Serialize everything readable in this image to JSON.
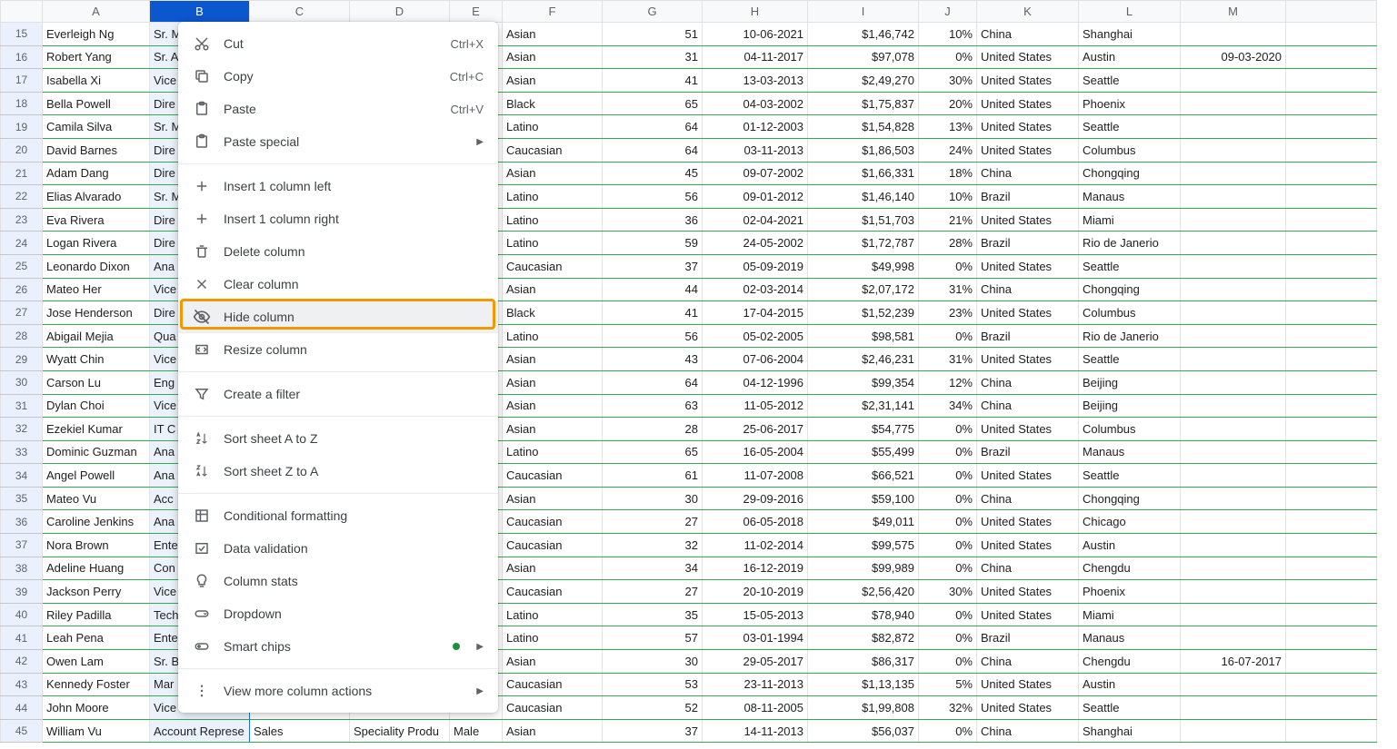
{
  "columns": [
    "A",
    "B",
    "C",
    "D",
    "E",
    "F",
    "G",
    "H",
    "I",
    "J",
    "K",
    "L",
    "M"
  ],
  "startRow": 15,
  "selectedColumn": "B",
  "rows": [
    {
      "n": 15,
      "A": "Everleigh Ng",
      "B": "Sr. M",
      "C": "",
      "D": "",
      "E": "",
      "F": "Asian",
      "G": "51",
      "H": "10-06-2021",
      "I": "$1,46,742",
      "J": "10%",
      "K": "China",
      "L": "Shanghai",
      "M": ""
    },
    {
      "n": 16,
      "A": "Robert Yang",
      "B": "Sr. A",
      "C": "",
      "D": "",
      "E": "",
      "F": "Asian",
      "G": "31",
      "H": "04-11-2017",
      "I": "$97,078",
      "J": "0%",
      "K": "United States",
      "L": "Austin",
      "M": "09-03-2020"
    },
    {
      "n": 17,
      "A": "Isabella Xi",
      "B": "Vice",
      "C": "",
      "D": "",
      "E": "e",
      "F": "Asian",
      "G": "41",
      "H": "13-03-2013",
      "I": "$2,49,270",
      "J": "30%",
      "K": "United States",
      "L": "Seattle",
      "M": ""
    },
    {
      "n": 18,
      "A": "Bella Powell",
      "B": "Dire",
      "C": "",
      "D": "",
      "E": "e",
      "F": "Black",
      "G": "65",
      "H": "04-03-2002",
      "I": "$1,75,837",
      "J": "20%",
      "K": "United States",
      "L": "Phoenix",
      "M": ""
    },
    {
      "n": 19,
      "A": "Camila Silva",
      "B": "Sr. M",
      "C": "",
      "D": "",
      "E": "e",
      "F": "Latino",
      "G": "64",
      "H": "01-12-2003",
      "I": "$1,54,828",
      "J": "13%",
      "K": "United States",
      "L": "Seattle",
      "M": ""
    },
    {
      "n": 20,
      "A": "David Barnes",
      "B": "Dire",
      "C": "",
      "D": "",
      "E": "",
      "F": "Caucasian",
      "G": "64",
      "H": "03-11-2013",
      "I": "$1,86,503",
      "J": "24%",
      "K": "United States",
      "L": "Columbus",
      "M": ""
    },
    {
      "n": 21,
      "A": "Adam Dang",
      "B": "Dire",
      "C": "",
      "D": "",
      "E": "",
      "F": "Asian",
      "G": "45",
      "H": "09-07-2002",
      "I": "$1,66,331",
      "J": "18%",
      "K": "China",
      "L": "Chongqing",
      "M": ""
    },
    {
      "n": 22,
      "A": "Elias Alvarado",
      "B": "Sr. M",
      "C": "",
      "D": "",
      "E": "",
      "F": "Latino",
      "G": "56",
      "H": "09-01-2012",
      "I": "$1,46,140",
      "J": "10%",
      "K": "Brazil",
      "L": "Manaus",
      "M": ""
    },
    {
      "n": 23,
      "A": "Eva Rivera",
      "B": "Dire",
      "C": "",
      "D": "",
      "E": "e",
      "F": "Latino",
      "G": "36",
      "H": "02-04-2021",
      "I": "$1,51,703",
      "J": "21%",
      "K": "United States",
      "L": "Miami",
      "M": ""
    },
    {
      "n": 24,
      "A": "Logan Rivera",
      "B": "Dire",
      "C": "",
      "D": "",
      "E": "",
      "F": "Latino",
      "G": "59",
      "H": "24-05-2002",
      "I": "$1,72,787",
      "J": "28%",
      "K": "Brazil",
      "L": "Rio de Janerio",
      "M": ""
    },
    {
      "n": 25,
      "A": "Leonardo Dixon",
      "B": "Ana",
      "C": "",
      "D": "",
      "E": "",
      "F": "Caucasian",
      "G": "37",
      "H": "05-09-2019",
      "I": "$49,998",
      "J": "0%",
      "K": "United States",
      "L": "Seattle",
      "M": ""
    },
    {
      "n": 26,
      "A": "Mateo Her",
      "B": "Vice",
      "C": "",
      "D": "",
      "E": "",
      "F": "Asian",
      "G": "44",
      "H": "02-03-2014",
      "I": "$2,07,172",
      "J": "31%",
      "K": "China",
      "L": "Chongqing",
      "M": ""
    },
    {
      "n": 27,
      "A": "Jose Henderson",
      "B": "Dire",
      "C": "",
      "D": "",
      "E": "",
      "F": "Black",
      "G": "41",
      "H": "17-04-2015",
      "I": "$1,52,239",
      "J": "23%",
      "K": "United States",
      "L": "Columbus",
      "M": ""
    },
    {
      "n": 28,
      "A": "Abigail Mejia",
      "B": "Qua",
      "C": "",
      "D": "",
      "E": "e",
      "F": "Latino",
      "G": "56",
      "H": "05-02-2005",
      "I": "$98,581",
      "J": "0%",
      "K": "Brazil",
      "L": "Rio de Janerio",
      "M": ""
    },
    {
      "n": 29,
      "A": "Wyatt Chin",
      "B": "Vice",
      "C": "",
      "D": "",
      "E": "",
      "F": "Asian",
      "G": "43",
      "H": "07-06-2004",
      "I": "$2,46,231",
      "J": "31%",
      "K": "United States",
      "L": "Seattle",
      "M": ""
    },
    {
      "n": 30,
      "A": "Carson Lu",
      "B": "Eng",
      "C": "",
      "D": "",
      "E": "",
      "F": "Asian",
      "G": "64",
      "H": "04-12-1996",
      "I": "$99,354",
      "J": "12%",
      "K": "China",
      "L": "Beijing",
      "M": ""
    },
    {
      "n": 31,
      "A": "Dylan Choi",
      "B": "Vice",
      "C": "",
      "D": "",
      "E": "",
      "F": "Asian",
      "G": "63",
      "H": "11-05-2012",
      "I": "$2,31,141",
      "J": "34%",
      "K": "China",
      "L": "Beijing",
      "M": ""
    },
    {
      "n": 32,
      "A": "Ezekiel Kumar",
      "B": "IT C",
      "C": "",
      "D": "",
      "E": "",
      "F": "Asian",
      "G": "28",
      "H": "25-06-2017",
      "I": "$54,775",
      "J": "0%",
      "K": "United States",
      "L": "Columbus",
      "M": ""
    },
    {
      "n": 33,
      "A": "Dominic Guzman",
      "B": "Ana",
      "C": "",
      "D": "",
      "E": "",
      "F": "Latino",
      "G": "65",
      "H": "16-05-2004",
      "I": "$55,499",
      "J": "0%",
      "K": "Brazil",
      "L": "Manaus",
      "M": ""
    },
    {
      "n": 34,
      "A": "Angel Powell",
      "B": "Ana",
      "C": "",
      "D": "",
      "E": "e",
      "F": "Caucasian",
      "G": "61",
      "H": "11-07-2008",
      "I": "$66,521",
      "J": "0%",
      "K": "United States",
      "L": "Seattle",
      "M": ""
    },
    {
      "n": 35,
      "A": "Mateo Vu",
      "B": "Acc",
      "C": "",
      "D": "",
      "E": "",
      "F": "Asian",
      "G": "30",
      "H": "29-09-2016",
      "I": "$59,100",
      "J": "0%",
      "K": "China",
      "L": "Chongqing",
      "M": ""
    },
    {
      "n": 36,
      "A": "Caroline Jenkins",
      "B": "Ana",
      "C": "",
      "D": "",
      "E": "e",
      "F": "Caucasian",
      "G": "27",
      "H": "06-05-2018",
      "I": "$49,011",
      "J": "0%",
      "K": "United States",
      "L": "Chicago",
      "M": ""
    },
    {
      "n": 37,
      "A": "Nora Brown",
      "B": "Ente",
      "C": "",
      "D": "",
      "E": "e",
      "F": "Caucasian",
      "G": "32",
      "H": "11-02-2014",
      "I": "$99,575",
      "J": "0%",
      "K": "United States",
      "L": "Austin",
      "M": ""
    },
    {
      "n": 38,
      "A": "Adeline Huang",
      "B": "Con",
      "C": "",
      "D": "",
      "E": "e",
      "F": "Asian",
      "G": "34",
      "H": "16-12-2019",
      "I": "$99,989",
      "J": "0%",
      "K": "China",
      "L": "Chengdu",
      "M": ""
    },
    {
      "n": 39,
      "A": "Jackson Perry",
      "B": "Vice",
      "C": "",
      "D": "",
      "E": "",
      "F": "Caucasian",
      "G": "27",
      "H": "20-10-2019",
      "I": "$2,56,420",
      "J": "30%",
      "K": "United States",
      "L": "Phoenix",
      "M": ""
    },
    {
      "n": 40,
      "A": "Riley Padilla",
      "B": "Tech",
      "C": "",
      "D": "",
      "E": "e",
      "F": "Latino",
      "G": "35",
      "H": "15-05-2013",
      "I": "$78,940",
      "J": "0%",
      "K": "United States",
      "L": "Miami",
      "M": ""
    },
    {
      "n": 41,
      "A": "Leah Pena",
      "B": "Ente",
      "C": "",
      "D": "",
      "E": "e",
      "F": "Latino",
      "G": "57",
      "H": "03-01-1994",
      "I": "$82,872",
      "J": "0%",
      "K": "Brazil",
      "L": "Manaus",
      "M": ""
    },
    {
      "n": 42,
      "A": "Owen Lam",
      "B": "Sr. B",
      "C": "",
      "D": "",
      "E": "",
      "F": "Asian",
      "G": "30",
      "H": "29-05-2017",
      "I": "$86,317",
      "J": "0%",
      "K": "China",
      "L": "Chengdu",
      "M": "16-07-2017"
    },
    {
      "n": 43,
      "A": "Kennedy Foster",
      "B": "Mar",
      "C": "",
      "D": "",
      "E": "e",
      "F": "Caucasian",
      "G": "53",
      "H": "23-11-2013",
      "I": "$1,13,135",
      "J": "5%",
      "K": "United States",
      "L": "Austin",
      "M": ""
    },
    {
      "n": 44,
      "A": "John Moore",
      "B": "Vice",
      "C": "",
      "D": "",
      "E": "",
      "F": "Caucasian",
      "G": "52",
      "H": "08-11-2005",
      "I": "$1,99,808",
      "J": "32%",
      "K": "United States",
      "L": "Seattle",
      "M": ""
    },
    {
      "n": 45,
      "A": "William Vu",
      "B": "Account Represe",
      "C": "Sales",
      "D": "Speciality Produ",
      "E": "Male",
      "F": "Asian",
      "G": "37",
      "H": "14-11-2013",
      "I": "$56,037",
      "J": "0%",
      "K": "China",
      "L": "Shanghai",
      "M": ""
    }
  ],
  "menu": {
    "cut": {
      "label": "Cut",
      "short": "Ctrl+X"
    },
    "copy": {
      "label": "Copy",
      "short": "Ctrl+C"
    },
    "paste": {
      "label": "Paste",
      "short": "Ctrl+V"
    },
    "paste_special": {
      "label": "Paste special"
    },
    "insert_left": {
      "label": "Insert 1 column left"
    },
    "insert_right": {
      "label": "Insert 1 column right"
    },
    "delete_col": {
      "label": "Delete column"
    },
    "clear_col": {
      "label": "Clear column"
    },
    "hide_col": {
      "label": "Hide column"
    },
    "resize_col": {
      "label": "Resize column"
    },
    "create_filter": {
      "label": "Create a filter"
    },
    "sort_az": {
      "label": "Sort sheet A to Z"
    },
    "sort_za": {
      "label": "Sort sheet Z to A"
    },
    "cond_fmt": {
      "label": "Conditional formatting"
    },
    "data_val": {
      "label": "Data validation"
    },
    "col_stats": {
      "label": "Column stats"
    },
    "dropdown": {
      "label": "Dropdown"
    },
    "smart_chips": {
      "label": "Smart chips"
    },
    "view_more": {
      "label": "View more column actions"
    }
  }
}
